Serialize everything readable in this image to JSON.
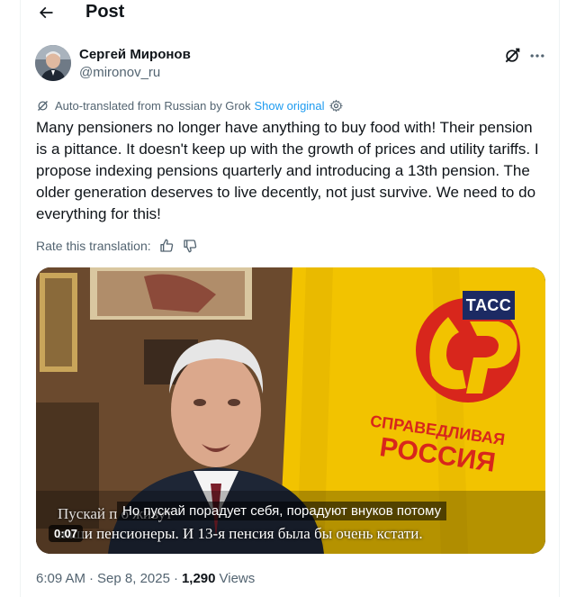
{
  "header": {
    "title": "Post",
    "back_icon": "arrow-left-icon"
  },
  "author": {
    "name": "Сергей Миронов",
    "handle": "@mironov_ru"
  },
  "translation": {
    "notice": "Auto-translated from Russian by Grok",
    "show_original": "Show original"
  },
  "post": {
    "text": "Many pensioners no longer have anything to buy food with! Their pension is a pittance. It doesn't keep up with the growth of prices and utility tariffs. I propose indexing pensions quarterly and introducing a 13th pension. The older generation deserves to live decently, not just survive. We need to do everything for this!"
  },
  "rate": {
    "label": "Rate this translation:"
  },
  "video": {
    "logo": "ТАСС",
    "burned_line1": "Пускай п                                              о живут",
    "burned_line2": "наши пенсионеры. И 13-я пенсия была бы очень кстати.",
    "caption": "Но пускай порадует себя, порадуют внуков потому",
    "elapsed": "0:07",
    "flag_text_1": "СПРАВЕДЛИВАЯ",
    "flag_text_2": "РОССИЯ"
  },
  "meta": {
    "time": "6:09 AM",
    "date": "Sep 8, 2025",
    "views_count": "1,290",
    "views_label": "Views"
  },
  "colors": {
    "link": "#1d9bf0",
    "muted": "#536471",
    "text": "#0f1419",
    "flag": "#f2c300",
    "flag_red": "#d8261c"
  }
}
